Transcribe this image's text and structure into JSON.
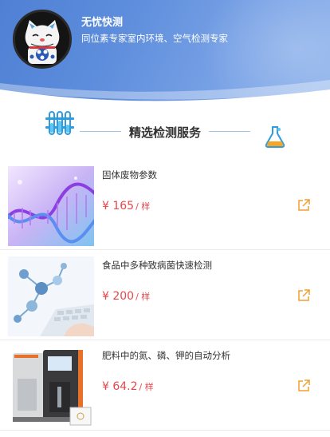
{
  "header": {
    "brand_name": "无忧快测",
    "slogan": "同位素专家室内环境、空气检测专家",
    "avatar_icon": "lucky-cat-icon"
  },
  "section": {
    "title": "精选检测服务",
    "left_icon": "test-tubes-icon",
    "right_icon": "flask-icon"
  },
  "products": [
    {
      "name": "固体废物参数",
      "price": "¥ 165",
      "unit": "/ 样",
      "image_icon": "dna-helix-image",
      "action_icon": "share-icon"
    },
    {
      "name": "食品中多种致病菌快速检测",
      "price": "¥ 200",
      "unit": "/ 样",
      "image_icon": "molecule-keyboard-image",
      "action_icon": "share-icon"
    },
    {
      "name": "肥料中的氮、磷、钾的自动分析",
      "price": "¥ 64.2",
      "unit": "/ 样",
      "image_icon": "lab-analyzer-image",
      "action_icon": "share-icon"
    }
  ],
  "colors": {
    "header_blue": "#5d8ddc",
    "price_red": "#e8464a",
    "accent_blue": "#2f9be0",
    "share_orange": "#f0a030"
  }
}
